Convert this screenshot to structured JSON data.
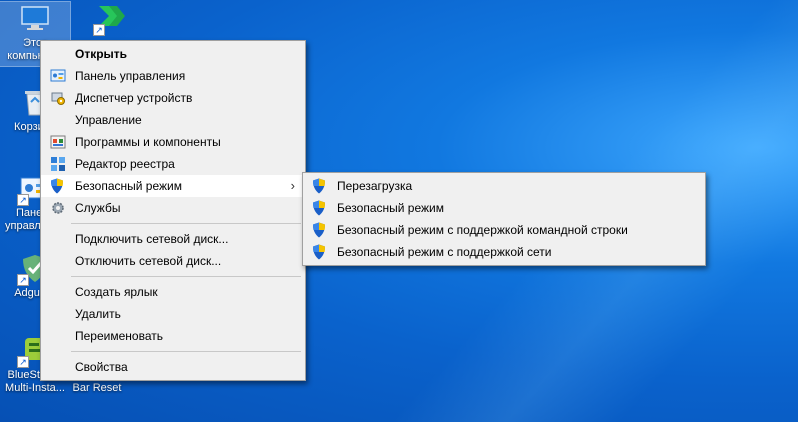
{
  "desktop": {
    "icons": [
      {
        "label": "Этот компьютер",
        "icon": "this-pc-icon"
      },
      {
        "label": "Корзина",
        "icon": "recycle-bin-icon"
      },
      {
        "label": "Панель управления",
        "icon": "control-panel-icon"
      },
      {
        "label": "Adguard",
        "icon": "adguard-icon"
      },
      {
        "label": "BlueStacks Multi-Insta...",
        "icon": "bluestacks-icon"
      },
      {
        "label": "Xbox Game Bar Reset",
        "icon": "xbox-reset-icon"
      },
      {
        "label": "",
        "icon": "green-arrows-icon"
      }
    ]
  },
  "context_menu": {
    "items": [
      {
        "label": "Открыть",
        "bold": true
      },
      {
        "label": "Панель управления",
        "icon": "control-panel-icon"
      },
      {
        "label": "Диспетчер устройств",
        "icon": "device-manager-icon"
      },
      {
        "label": "Управление"
      },
      {
        "label": "Программы и компоненты",
        "icon": "programs-icon"
      },
      {
        "label": "Редактор реестра",
        "icon": "registry-editor-icon"
      },
      {
        "label": "Безопасный режим",
        "icon": "shield-icon",
        "submenu": true
      },
      {
        "label": "Службы",
        "icon": "services-gear-icon"
      },
      {
        "label": "Подключить сетевой диск..."
      },
      {
        "label": "Отключить сетевой диск..."
      },
      {
        "label": "Создать ярлык"
      },
      {
        "label": "Удалить"
      },
      {
        "label": "Переименовать"
      },
      {
        "label": "Свойства"
      }
    ],
    "submenu_arrow": "›"
  },
  "submenu": {
    "items": [
      {
        "label": "Перезагрузка",
        "icon": "shield-icon"
      },
      {
        "label": "Безопасный режим",
        "icon": "shield-icon"
      },
      {
        "label": "Безопасный режим с поддержкой командной строки",
        "icon": "shield-icon"
      },
      {
        "label": "Безопасный режим с поддержкой сети",
        "icon": "shield-icon"
      }
    ]
  },
  "colors": {
    "menu_bg": "#f0f0f0",
    "desktop_blue": "#0a62cc",
    "shield_blue": "#1a5fc8",
    "shield_yellow": "#f5c400"
  }
}
